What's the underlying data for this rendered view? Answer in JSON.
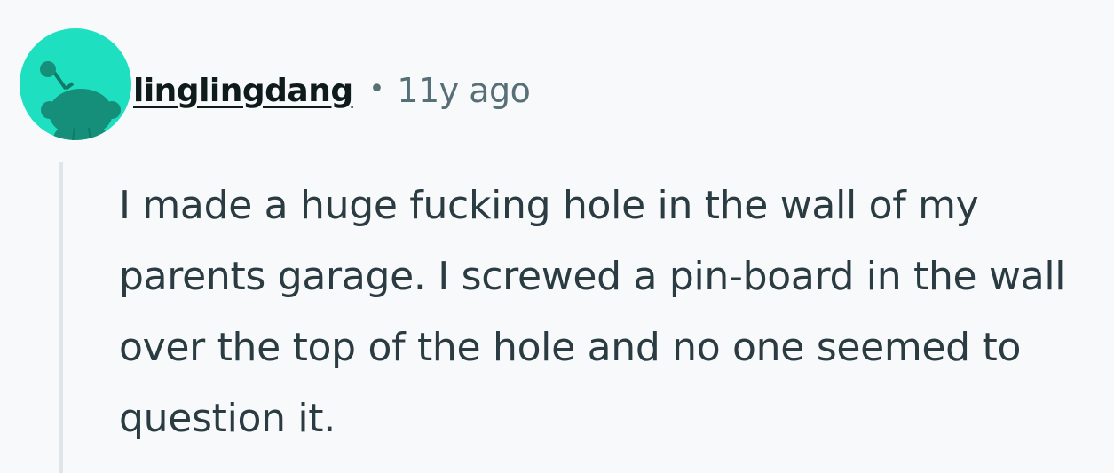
{
  "comment": {
    "avatar_icon": "reddit-snoo-avatar-icon",
    "avatar_color": "#1ee0c0",
    "username": "linglingdang",
    "separator": "•",
    "timestamp": "11y ago",
    "body": "I made a huge fucking hole in the wall of my parents garage. I screwed a pin-board in the wall over the top of the hole and no one seemed to question it."
  }
}
